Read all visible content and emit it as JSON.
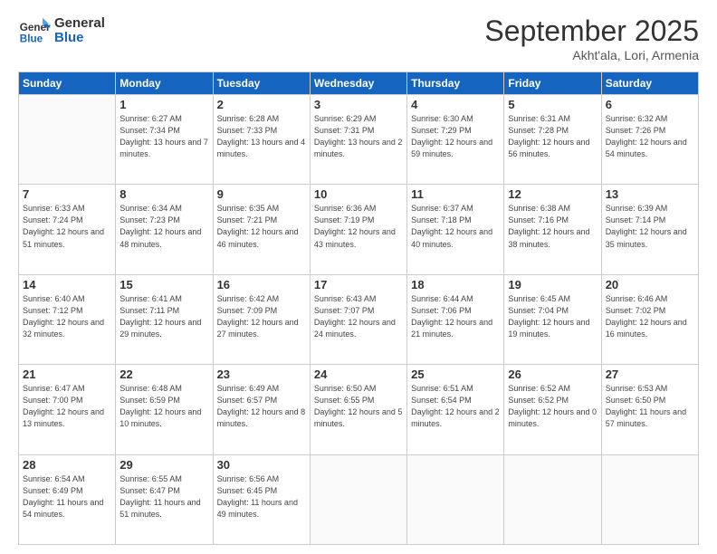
{
  "logo": {
    "line1": "General",
    "line2": "Blue"
  },
  "title": "September 2025",
  "subtitle": "Akht'ala, Lori, Armenia",
  "days_of_week": [
    "Sunday",
    "Monday",
    "Tuesday",
    "Wednesday",
    "Thursday",
    "Friday",
    "Saturday"
  ],
  "weeks": [
    [
      {
        "day": "",
        "empty": true
      },
      {
        "day": "1",
        "sunrise": "6:27 AM",
        "sunset": "7:34 PM",
        "daylight": "13 hours and 7 minutes."
      },
      {
        "day": "2",
        "sunrise": "6:28 AM",
        "sunset": "7:33 PM",
        "daylight": "13 hours and 4 minutes."
      },
      {
        "day": "3",
        "sunrise": "6:29 AM",
        "sunset": "7:31 PM",
        "daylight": "13 hours and 2 minutes."
      },
      {
        "day": "4",
        "sunrise": "6:30 AM",
        "sunset": "7:29 PM",
        "daylight": "12 hours and 59 minutes."
      },
      {
        "day": "5",
        "sunrise": "6:31 AM",
        "sunset": "7:28 PM",
        "daylight": "12 hours and 56 minutes."
      },
      {
        "day": "6",
        "sunrise": "6:32 AM",
        "sunset": "7:26 PM",
        "daylight": "12 hours and 54 minutes."
      }
    ],
    [
      {
        "day": "7",
        "sunrise": "6:33 AM",
        "sunset": "7:24 PM",
        "daylight": "12 hours and 51 minutes."
      },
      {
        "day": "8",
        "sunrise": "6:34 AM",
        "sunset": "7:23 PM",
        "daylight": "12 hours and 48 minutes."
      },
      {
        "day": "9",
        "sunrise": "6:35 AM",
        "sunset": "7:21 PM",
        "daylight": "12 hours and 46 minutes."
      },
      {
        "day": "10",
        "sunrise": "6:36 AM",
        "sunset": "7:19 PM",
        "daylight": "12 hours and 43 minutes."
      },
      {
        "day": "11",
        "sunrise": "6:37 AM",
        "sunset": "7:18 PM",
        "daylight": "12 hours and 40 minutes."
      },
      {
        "day": "12",
        "sunrise": "6:38 AM",
        "sunset": "7:16 PM",
        "daylight": "12 hours and 38 minutes."
      },
      {
        "day": "13",
        "sunrise": "6:39 AM",
        "sunset": "7:14 PM",
        "daylight": "12 hours and 35 minutes."
      }
    ],
    [
      {
        "day": "14",
        "sunrise": "6:40 AM",
        "sunset": "7:12 PM",
        "daylight": "12 hours and 32 minutes."
      },
      {
        "day": "15",
        "sunrise": "6:41 AM",
        "sunset": "7:11 PM",
        "daylight": "12 hours and 29 minutes."
      },
      {
        "day": "16",
        "sunrise": "6:42 AM",
        "sunset": "7:09 PM",
        "daylight": "12 hours and 27 minutes."
      },
      {
        "day": "17",
        "sunrise": "6:43 AM",
        "sunset": "7:07 PM",
        "daylight": "12 hours and 24 minutes."
      },
      {
        "day": "18",
        "sunrise": "6:44 AM",
        "sunset": "7:06 PM",
        "daylight": "12 hours and 21 minutes."
      },
      {
        "day": "19",
        "sunrise": "6:45 AM",
        "sunset": "7:04 PM",
        "daylight": "12 hours and 19 minutes."
      },
      {
        "day": "20",
        "sunrise": "6:46 AM",
        "sunset": "7:02 PM",
        "daylight": "12 hours and 16 minutes."
      }
    ],
    [
      {
        "day": "21",
        "sunrise": "6:47 AM",
        "sunset": "7:00 PM",
        "daylight": "12 hours and 13 minutes."
      },
      {
        "day": "22",
        "sunrise": "6:48 AM",
        "sunset": "6:59 PM",
        "daylight": "12 hours and 10 minutes."
      },
      {
        "day": "23",
        "sunrise": "6:49 AM",
        "sunset": "6:57 PM",
        "daylight": "12 hours and 8 minutes."
      },
      {
        "day": "24",
        "sunrise": "6:50 AM",
        "sunset": "6:55 PM",
        "daylight": "12 hours and 5 minutes."
      },
      {
        "day": "25",
        "sunrise": "6:51 AM",
        "sunset": "6:54 PM",
        "daylight": "12 hours and 2 minutes."
      },
      {
        "day": "26",
        "sunrise": "6:52 AM",
        "sunset": "6:52 PM",
        "daylight": "12 hours and 0 minutes."
      },
      {
        "day": "27",
        "sunrise": "6:53 AM",
        "sunset": "6:50 PM",
        "daylight": "11 hours and 57 minutes."
      }
    ],
    [
      {
        "day": "28",
        "sunrise": "6:54 AM",
        "sunset": "6:49 PM",
        "daylight": "11 hours and 54 minutes."
      },
      {
        "day": "29",
        "sunrise": "6:55 AM",
        "sunset": "6:47 PM",
        "daylight": "11 hours and 51 minutes."
      },
      {
        "day": "30",
        "sunrise": "6:56 AM",
        "sunset": "6:45 PM",
        "daylight": "11 hours and 49 minutes."
      },
      {
        "day": "",
        "empty": true
      },
      {
        "day": "",
        "empty": true
      },
      {
        "day": "",
        "empty": true
      },
      {
        "day": "",
        "empty": true
      }
    ]
  ]
}
